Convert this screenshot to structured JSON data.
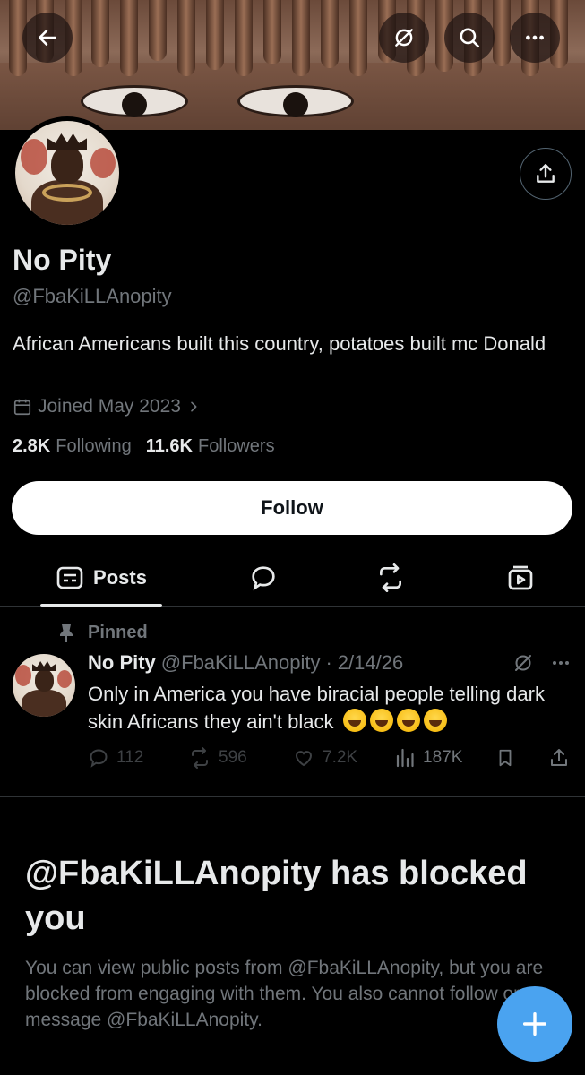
{
  "profile": {
    "name": "No Pity",
    "handle": "@FbaKiLLAnopity",
    "bio": "African Americans built this country, potatoes built mc Donald",
    "joined": "Joined May 2023",
    "following_count": "2.8K",
    "following_label": "Following",
    "followers_count": "11.6K",
    "followers_label": "Followers"
  },
  "actions": {
    "follow_label": "Follow"
  },
  "tabs": [
    {
      "label": "Posts",
      "icon": "posts-icon",
      "active": true
    },
    {
      "label": "",
      "icon": "replies-icon"
    },
    {
      "label": "",
      "icon": "repost-icon"
    },
    {
      "label": "",
      "icon": "media-icon"
    }
  ],
  "pinned_post": {
    "pinned_label": "Pinned",
    "author_name": "No Pity",
    "author_handle": "@FbaKiLLAnopity",
    "separator": "·",
    "date": "2/14/26",
    "text": "Only in America you have biracial people telling dark skin Africans they ain't black",
    "emoji": "face-with-tears-of-joy x4",
    "replies": "112",
    "reposts": "596",
    "likes": "7.2K",
    "views": "187K"
  },
  "blocked": {
    "title": "@FbaKiLLAnopity has blocked you",
    "message": "You can view public posts from @FbaKiLLAnopity, but you are blocked from engaging with them. You also cannot follow or message @FbaKiLLAnopity."
  },
  "colors": {
    "background": "#000000",
    "text_primary": "#e7e9ea",
    "text_secondary": "#71767b",
    "divider": "#2f3336",
    "fab": "#4aa3f0"
  }
}
